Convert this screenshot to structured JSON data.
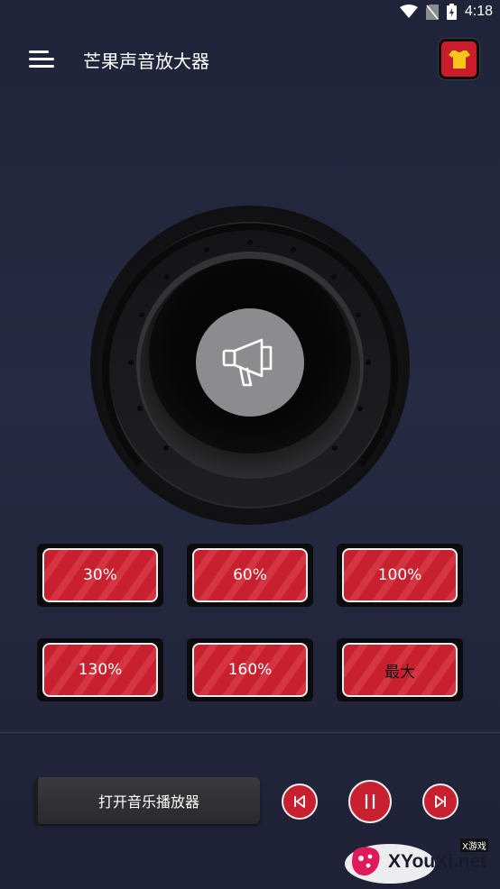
{
  "status_bar": {
    "time": "4:18"
  },
  "app_bar": {
    "title": "芒果声音放大器",
    "menu_icon": "hamburger-menu-icon",
    "theme_icon": "tshirt-icon"
  },
  "amplifier": {
    "center_icon": "megaphone-icon"
  },
  "boost_levels": [
    {
      "label": "30%"
    },
    {
      "label": "60%"
    },
    {
      "label": "100%"
    },
    {
      "label": "130%"
    },
    {
      "label": "160%"
    },
    {
      "label": "最大"
    }
  ],
  "player": {
    "open_label": "打开音乐播放器",
    "prev_icon": "skip-previous-icon",
    "pause_icon": "pause-icon",
    "next_icon": "skip-next-icon"
  },
  "watermark": {
    "text": "XYouXi.net",
    "small": "X游戏"
  },
  "colors": {
    "accent": "#c8202e",
    "background": "#22263c",
    "button_frame": "#0c0c0e"
  }
}
